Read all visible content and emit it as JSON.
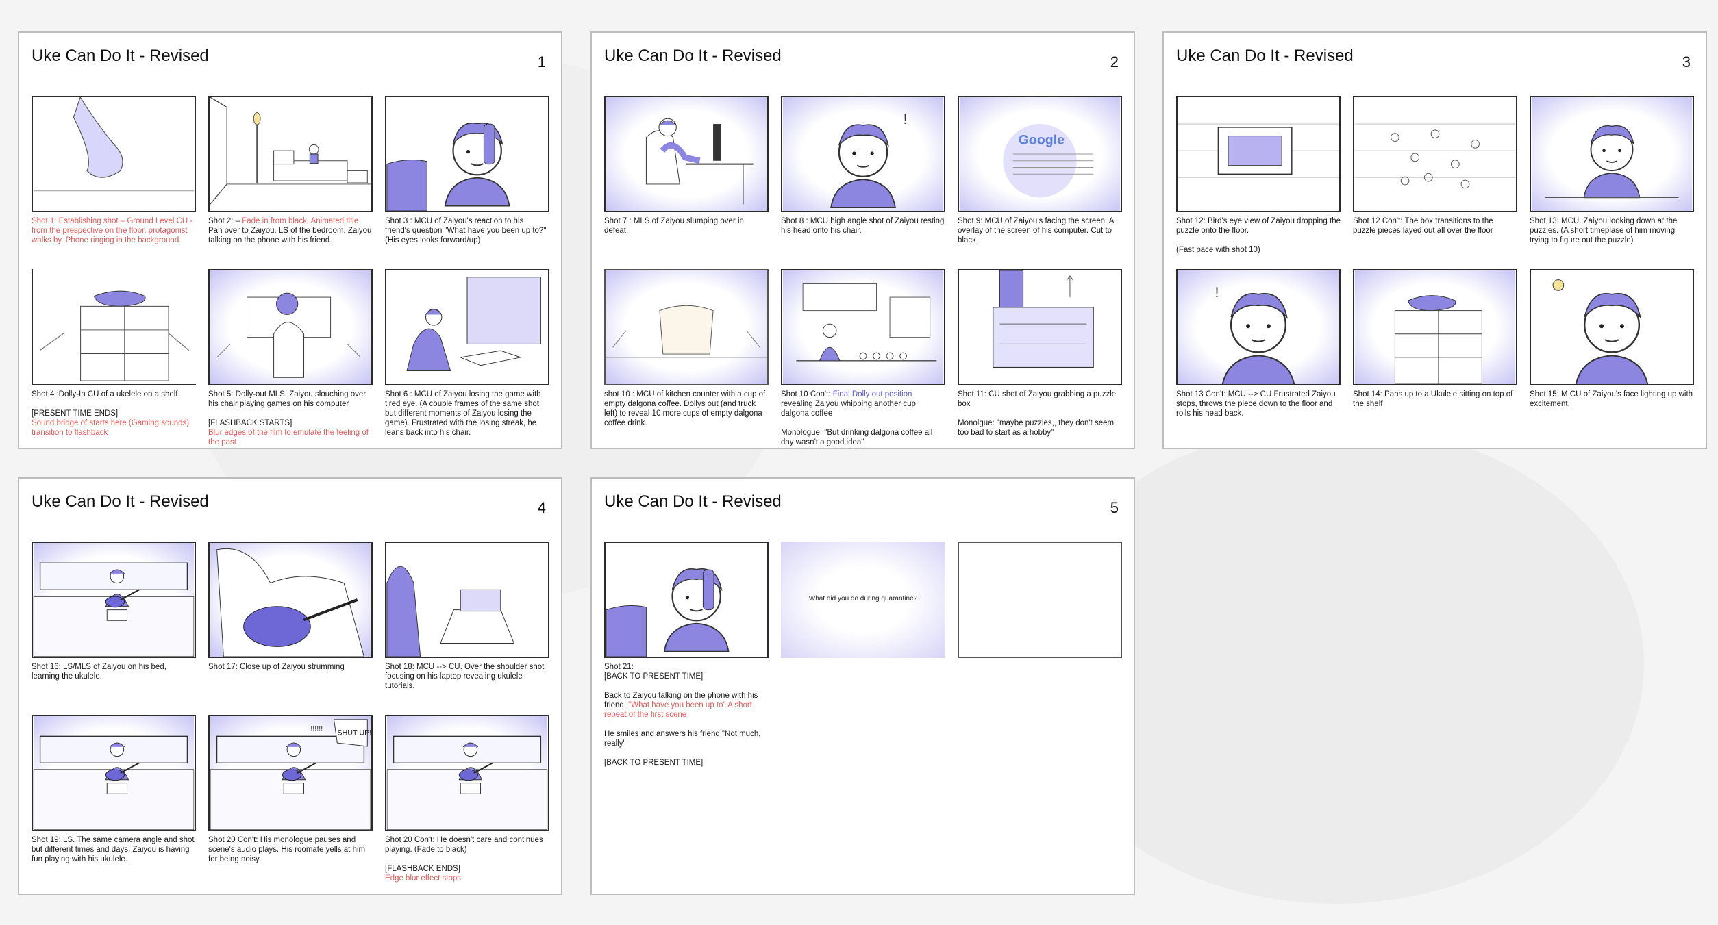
{
  "storyboard_title": "Uke Can Do It - Revised",
  "colors": {
    "accent_red": "#e85a5a",
    "accent_blue": "#5b56d6",
    "sketch_fill": "#8c86e0"
  },
  "pages": [
    {
      "number": "1",
      "shots": [
        {
          "lines": [
            {
              "t": "Shot 1: Establishing shot – Ground Level CU - from the prespective on the floor, protagonist walks by. Phone ringing in the background.",
              "c": "red"
            }
          ]
        },
        {
          "lines": [
            {
              "t": "Shot 2: – ",
              "c": "",
              "inline": [
                {
                  "t": "Fade in from black. Animated title",
                  "c": "red"
                }
              ]
            },
            {
              "t": "Pan over to Zaiyou. LS of the bedroom. Zaiyou talking on the phone with his friend.",
              "c": ""
            }
          ]
        },
        {
          "lines": [
            {
              "t": "Shot 3 : MCU of Zaiyou's reaction to his friend's question \"What have you been up to?\" (His eyes looks forward/up)",
              "c": ""
            }
          ]
        },
        {
          "lines": [
            {
              "t": "Shot 4 :Dolly-In CU of a ukelele on a shelf.",
              "c": ""
            },
            {
              "t": "",
              "c": "gap"
            },
            {
              "t": "[PRESENT TIME ENDS]",
              "c": ""
            },
            {
              "t": "Sound bridge of starts here (Gaming sounds) transition to flashback",
              "c": "red"
            }
          ]
        },
        {
          "lines": [
            {
              "t": "Shot 5: Dolly-out MLS. Zaiyou slouching over his chair playing games on his computer",
              "c": ""
            },
            {
              "t": "",
              "c": "gap"
            },
            {
              "t": "[FLASHBACK STARTS]",
              "c": ""
            },
            {
              "t": "Blur edges of the film to emulate the feeling of the past",
              "c": "red"
            }
          ]
        },
        {
          "lines": [
            {
              "t": "Shot 6 : MCU of Zaiyou losing the game with tired eye. (A couple frames of the same shot but different moments of Zaiyou losing the game). Frustrated with the losing streak, he leans back into his chair.",
              "c": ""
            }
          ]
        }
      ]
    },
    {
      "number": "2",
      "shots": [
        {
          "lines": [
            {
              "t": "Shot 7 : MLS of Zaiyou slumping over in defeat.",
              "c": ""
            }
          ]
        },
        {
          "lines": [
            {
              "t": "Shot 8 : MCU high angle shot of Zaiyou resting his head onto his chair.",
              "c": ""
            }
          ]
        },
        {
          "lines": [
            {
              "t": "Shot 9: MCU of Zaiyou's facing the screen. A overlay of the screen of his computer. Cut to black",
              "c": ""
            }
          ]
        },
        {
          "lines": [
            {
              "t": "shot 10 : MCU of kitchen counter with a cup of empty dalgona coffee. Dollys out (and truck left) to reveal 10 more cups of empty dalgona coffee drink.",
              "c": ""
            }
          ]
        },
        {
          "lines": [
            {
              "t": "Shot 10 Con't: ",
              "c": "",
              "inline": [
                {
                  "t": "Final Dolly out position",
                  "c": "blue"
                }
              ]
            },
            {
              "t": "revealing Zaiyou whipping another cup dalgona coffee",
              "c": ""
            },
            {
              "t": "",
              "c": "gap"
            },
            {
              "t": "Monologue: \"But drinking dalgona coffee all day wasn't a good idea\"",
              "c": ""
            }
          ]
        },
        {
          "lines": [
            {
              "t": "Shot 11: CU shot of Zaiyou grabbing a puzzle box",
              "c": ""
            },
            {
              "t": "",
              "c": "gap"
            },
            {
              "t": "Monolgue: \"maybe puzzles,, they don't seem too bad to start as a hobby\"",
              "c": ""
            }
          ]
        }
      ]
    },
    {
      "number": "3",
      "shots": [
        {
          "lines": [
            {
              "t": "Shot 12: Bird's eye view of Zaiyou dropping the puzzle onto the floor.",
              "c": ""
            },
            {
              "t": "",
              "c": "gap"
            },
            {
              "t": "(Fast pace with shot 10)",
              "c": ""
            }
          ]
        },
        {
          "lines": [
            {
              "t": "Shot 12 Con't: The box transitions to the puzzle pieces layed out all over the floor",
              "c": ""
            }
          ]
        },
        {
          "lines": [
            {
              "t": "Shot 13: MCU. Zaiyou looking down at the puzzles. (A short timeplase of him moving trying to figure out the puzzle)",
              "c": ""
            }
          ]
        },
        {
          "lines": [
            {
              "t": "Shot 13 Con't: MCU --> CU   Frustrated Zaiyou stops, throws the piece down to the floor and rolls his head back.",
              "c": ""
            }
          ]
        },
        {
          "lines": [
            {
              "t": "Shot 14: Pans up to a Ukulele sitting on top of the shelf",
              "c": ""
            }
          ]
        },
        {
          "lines": [
            {
              "t": "Shot 15: M CU of Zaiyou's face lighting up with excitement.",
              "c": ""
            }
          ]
        }
      ]
    },
    {
      "number": "4",
      "shots": [
        {
          "lines": [
            {
              "t": "Shot 16: LS/MLS of Zaiyou on his bed, learning the ukulele.",
              "c": ""
            }
          ]
        },
        {
          "lines": [
            {
              "t": "Shot 17: Close up of Zaiyou strumming",
              "c": ""
            }
          ]
        },
        {
          "lines": [
            {
              "t": "Shot 18: MCU --> CU. Over the shoulder shot focusing on his laptop revealing ukulele tutorials.",
              "c": ""
            }
          ]
        },
        {
          "lines": [
            {
              "t": "Shot 19: LS. The same camera angle and shot but different times and days. Zaiyou is having fun playing with his ukulele.",
              "c": ""
            }
          ]
        },
        {
          "lines": [
            {
              "t": "Shot 20 Con't: His monologue pauses and scene's audio plays. His roomate yells at him for being noisy.",
              "c": ""
            }
          ]
        },
        {
          "lines": [
            {
              "t": "Shot 20 Con't: He doesn't care and continues playing. (Fade to black)",
              "c": ""
            },
            {
              "t": "",
              "c": "gap"
            },
            {
              "t": "[FLASHBACK ENDS]",
              "c": ""
            },
            {
              "t": "Edge blur effect stops",
              "c": "red"
            }
          ]
        }
      ]
    },
    {
      "number": "5",
      "shots": [
        {
          "lines": [
            {
              "t": "Shot 21:",
              "c": ""
            },
            {
              "t": "[BACK TO PRESENT TIME]",
              "c": ""
            },
            {
              "t": "",
              "c": "gap"
            },
            {
              "t": "Back to Zaiyou talking on the phone with his friend.  ",
              "c": "",
              "inline": [
                {
                  "t": "\"What have you been up to\" A short repeat of the first scene",
                  "c": "red"
                }
              ]
            },
            {
              "t": "",
              "c": "gap"
            },
            {
              "t": "He smiles and answers his friend \"Not much, really\"",
              "c": ""
            },
            {
              "t": "",
              "c": "gap"
            },
            {
              "t": "[BACK TO PRESENT TIME]",
              "c": ""
            }
          ]
        },
        {
          "card_text": "What did you do during quarantine?",
          "lines": []
        },
        {
          "lines": []
        }
      ]
    }
  ],
  "sketch_text": {
    "shout": "SHUT UP!",
    "exclaim": "!!!!!!",
    "search_logo": "Google"
  }
}
